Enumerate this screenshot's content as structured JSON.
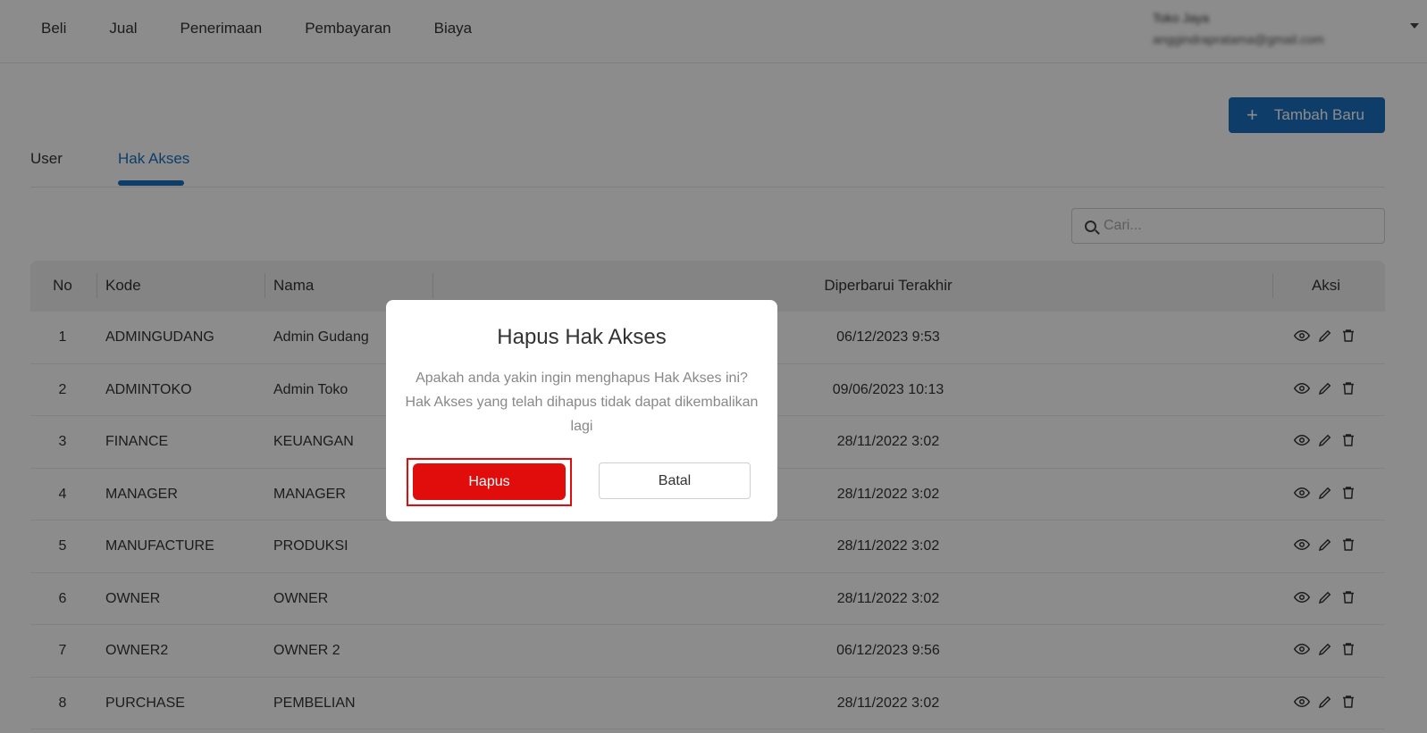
{
  "nav": {
    "items": [
      "Beli",
      "Jual",
      "Penerimaan",
      "Pembayaran",
      "Biaya"
    ],
    "account_name": "Toko Jaya",
    "account_email": "anggindrapratama@gmail.com"
  },
  "toolbar": {
    "add_label": "Tambah Baru"
  },
  "tabs": {
    "user": "User",
    "hak_akses": "Hak Akses"
  },
  "search": {
    "placeholder": "Cari..."
  },
  "table": {
    "headers": {
      "no": "No",
      "kode": "Kode",
      "nama": "Nama",
      "updated": "Diperbarui Terakhir",
      "aksi": "Aksi"
    },
    "rows": [
      {
        "no": "1",
        "kode": "ADMINGUDANG",
        "nama": "Admin Gudang",
        "updated": "06/12/2023 9:53"
      },
      {
        "no": "2",
        "kode": "ADMINTOKO",
        "nama": "Admin Toko",
        "updated": "09/06/2023 10:13"
      },
      {
        "no": "3",
        "kode": "FINANCE",
        "nama": "KEUANGAN",
        "updated": "28/11/2022 3:02"
      },
      {
        "no": "4",
        "kode": "MANAGER",
        "nama": "MANAGER",
        "updated": "28/11/2022 3:02"
      },
      {
        "no": "5",
        "kode": "MANUFACTURE",
        "nama": "PRODUKSI",
        "updated": "28/11/2022 3:02"
      },
      {
        "no": "6",
        "kode": "OWNER",
        "nama": "OWNER",
        "updated": "28/11/2022 3:02"
      },
      {
        "no": "7",
        "kode": "OWNER2",
        "nama": "OWNER 2",
        "updated": "06/12/2023 9:56"
      },
      {
        "no": "8",
        "kode": "PURCHASE",
        "nama": "PEMBELIAN",
        "updated": "28/11/2022 3:02"
      }
    ]
  },
  "modal": {
    "title": "Hapus Hak Akses",
    "message": "Apakah anda yakin ingin menghapus Hak Akses ini? Hak Akses yang telah dihapus tidak dapat dikembalikan lagi",
    "confirm_label": "Hapus",
    "cancel_label": "Batal",
    "confirm_color": "#e10d0d"
  },
  "colors": {
    "accent": "#1b6fc2",
    "danger": "#e10d0d"
  },
  "icons": {
    "view": "eye-icon",
    "edit": "pencil-icon",
    "delete": "trash-icon",
    "search": "search-icon",
    "add": "plus-icon"
  }
}
